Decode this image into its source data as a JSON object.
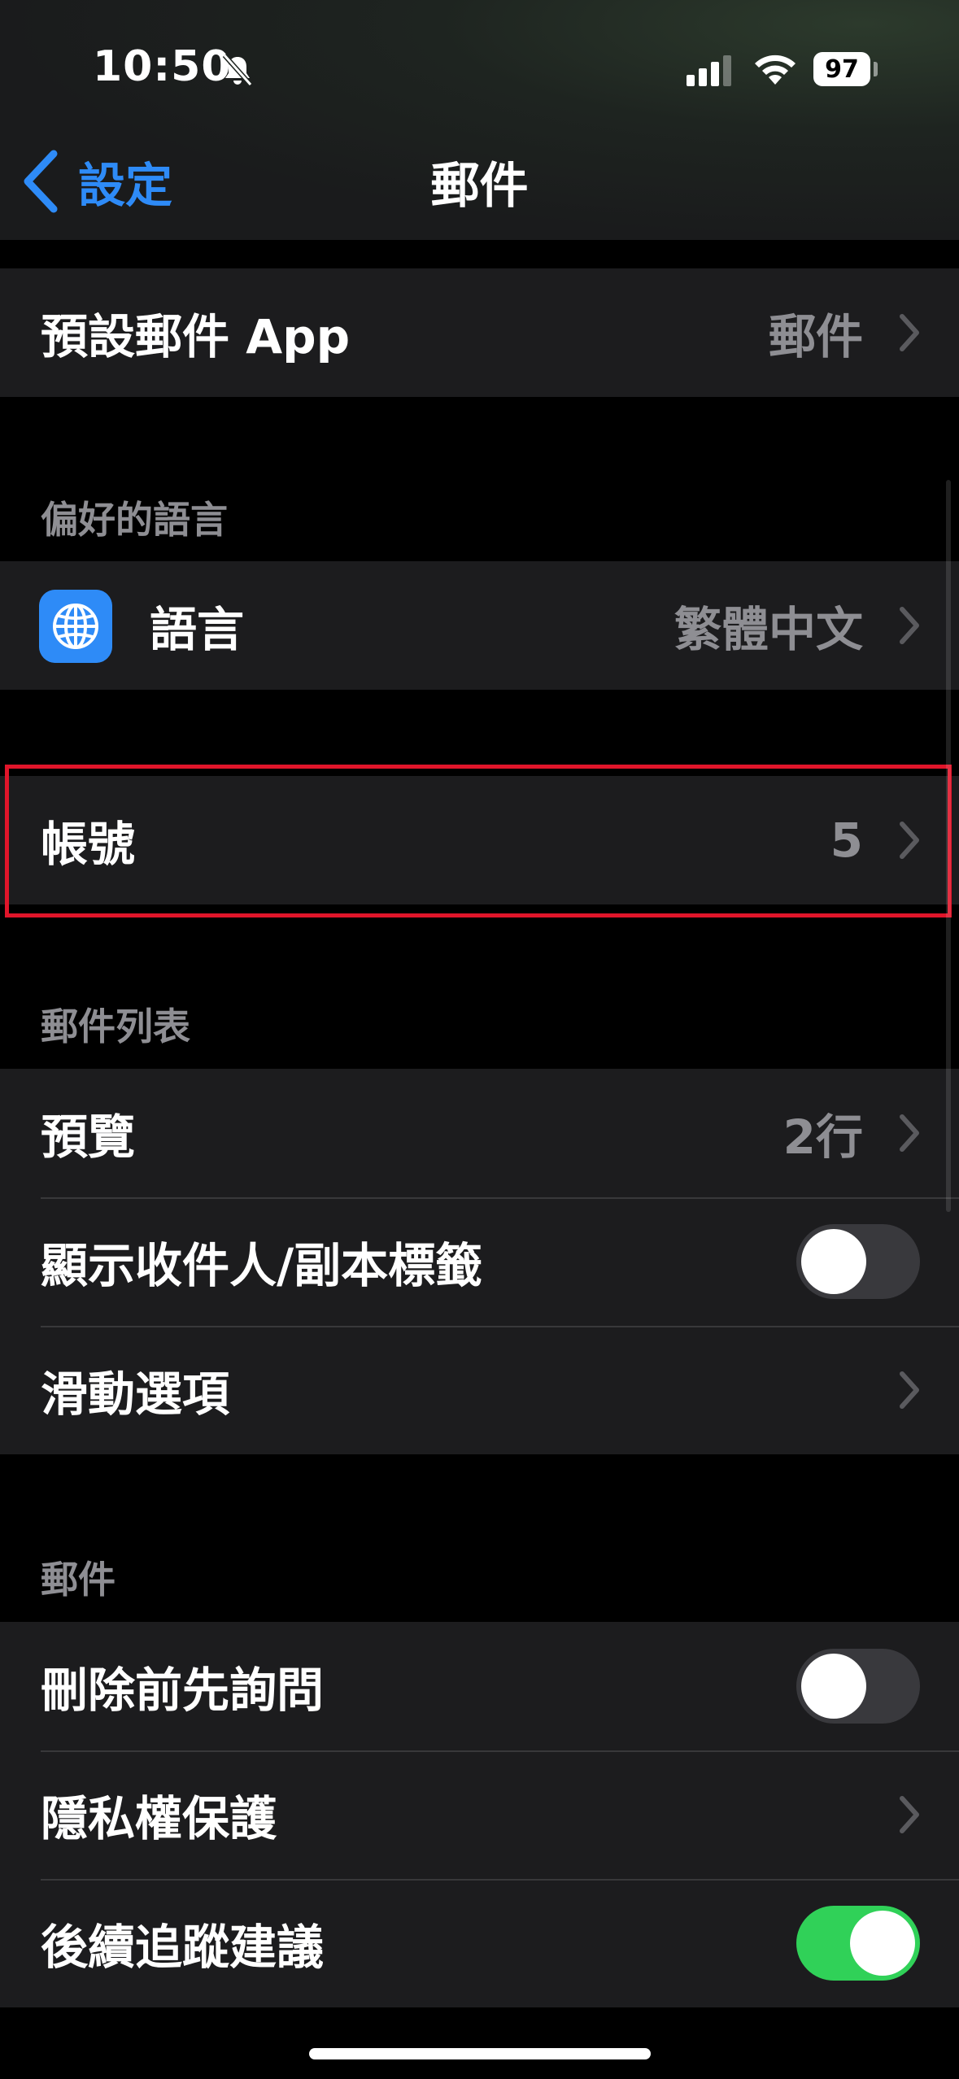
{
  "status_bar": {
    "time": "10:50",
    "battery": "97"
  },
  "nav": {
    "back_label": "設定",
    "title": "郵件"
  },
  "default_app": {
    "label": "預設郵件 App",
    "value": "郵件"
  },
  "language_section": {
    "header": "偏好的語言",
    "label": "語言",
    "value": "繁體中文"
  },
  "accounts": {
    "label": "帳號",
    "value": "5"
  },
  "message_list": {
    "header": "郵件列表",
    "preview_label": "預覽",
    "preview_value": "2行",
    "show_to_cc_label": "顯示收件人/副本標籤",
    "show_to_cc_on": false,
    "swipe_label": "滑動選項"
  },
  "messages": {
    "header": "郵件",
    "ask_before_delete_label": "刪除前先詢問",
    "ask_before_delete_on": false,
    "privacy_label": "隱私權保護",
    "follow_up_label": "後續追蹤建議",
    "follow_up_on": true
  },
  "colors": {
    "accent": "#2e8bf7",
    "toggle_on": "#30d158",
    "highlight": "#e0152a"
  }
}
